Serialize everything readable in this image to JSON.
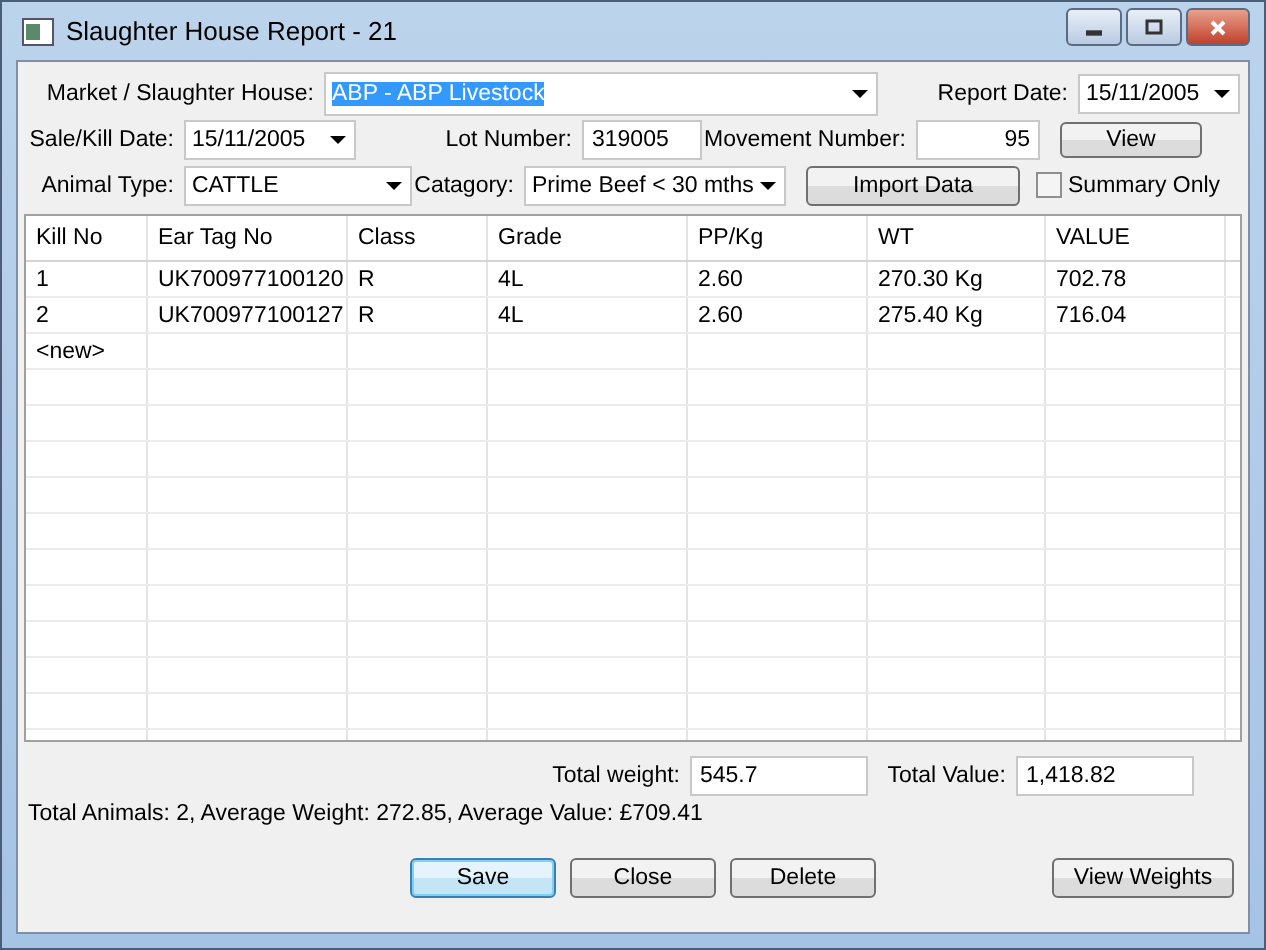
{
  "window": {
    "title": "Slaughter House Report - 21"
  },
  "form": {
    "market": {
      "label": "Market / Slaughter House:",
      "value": "ABP - ABP Livestock",
      "selected": true
    },
    "report_date": {
      "label": "Report Date:",
      "value": "15/11/2005"
    },
    "sale_date": {
      "label": "Sale/Kill Date:",
      "value": "15/11/2005"
    },
    "lot_number": {
      "label": "Lot Number:",
      "value": "319005"
    },
    "movement_number": {
      "label": "Movement Number:",
      "value": "95"
    },
    "view_button": "View",
    "animal_type": {
      "label": "Animal Type:",
      "value": "CATTLE"
    },
    "category": {
      "label": "Catagory:",
      "value": "Prime Beef < 30 mths"
    },
    "import_button": "Import Data",
    "summary_only": {
      "label": "Summary Only",
      "checked": false
    }
  },
  "table": {
    "columns": [
      "Kill No",
      "Ear Tag No",
      "Class",
      "Grade",
      "PP/Kg",
      "WT",
      "VALUE"
    ],
    "rows": [
      [
        "1",
        "UK700977100120",
        "R",
        "4L",
        "2.60",
        "270.30 Kg",
        "702.78"
      ],
      [
        "2",
        "UK700977100127",
        "R",
        "4L",
        "2.60",
        "275.40 Kg",
        "716.04"
      ],
      [
        "<new>",
        "",
        "",
        "",
        "",
        "",
        ""
      ]
    ]
  },
  "totals": {
    "weight_label": "Total weight:",
    "weight": "545.7",
    "value_label": "Total Value:",
    "value": "1,418.82"
  },
  "summary": "Total Animals: 2, Average Weight: 272.85, Average Value: £709.41",
  "buttons": [
    {
      "label": "Save",
      "default": true
    },
    {
      "label": "Close",
      "default": false
    },
    {
      "label": "Delete",
      "default": false
    }
  ],
  "view_weights_button": "View Weights"
}
